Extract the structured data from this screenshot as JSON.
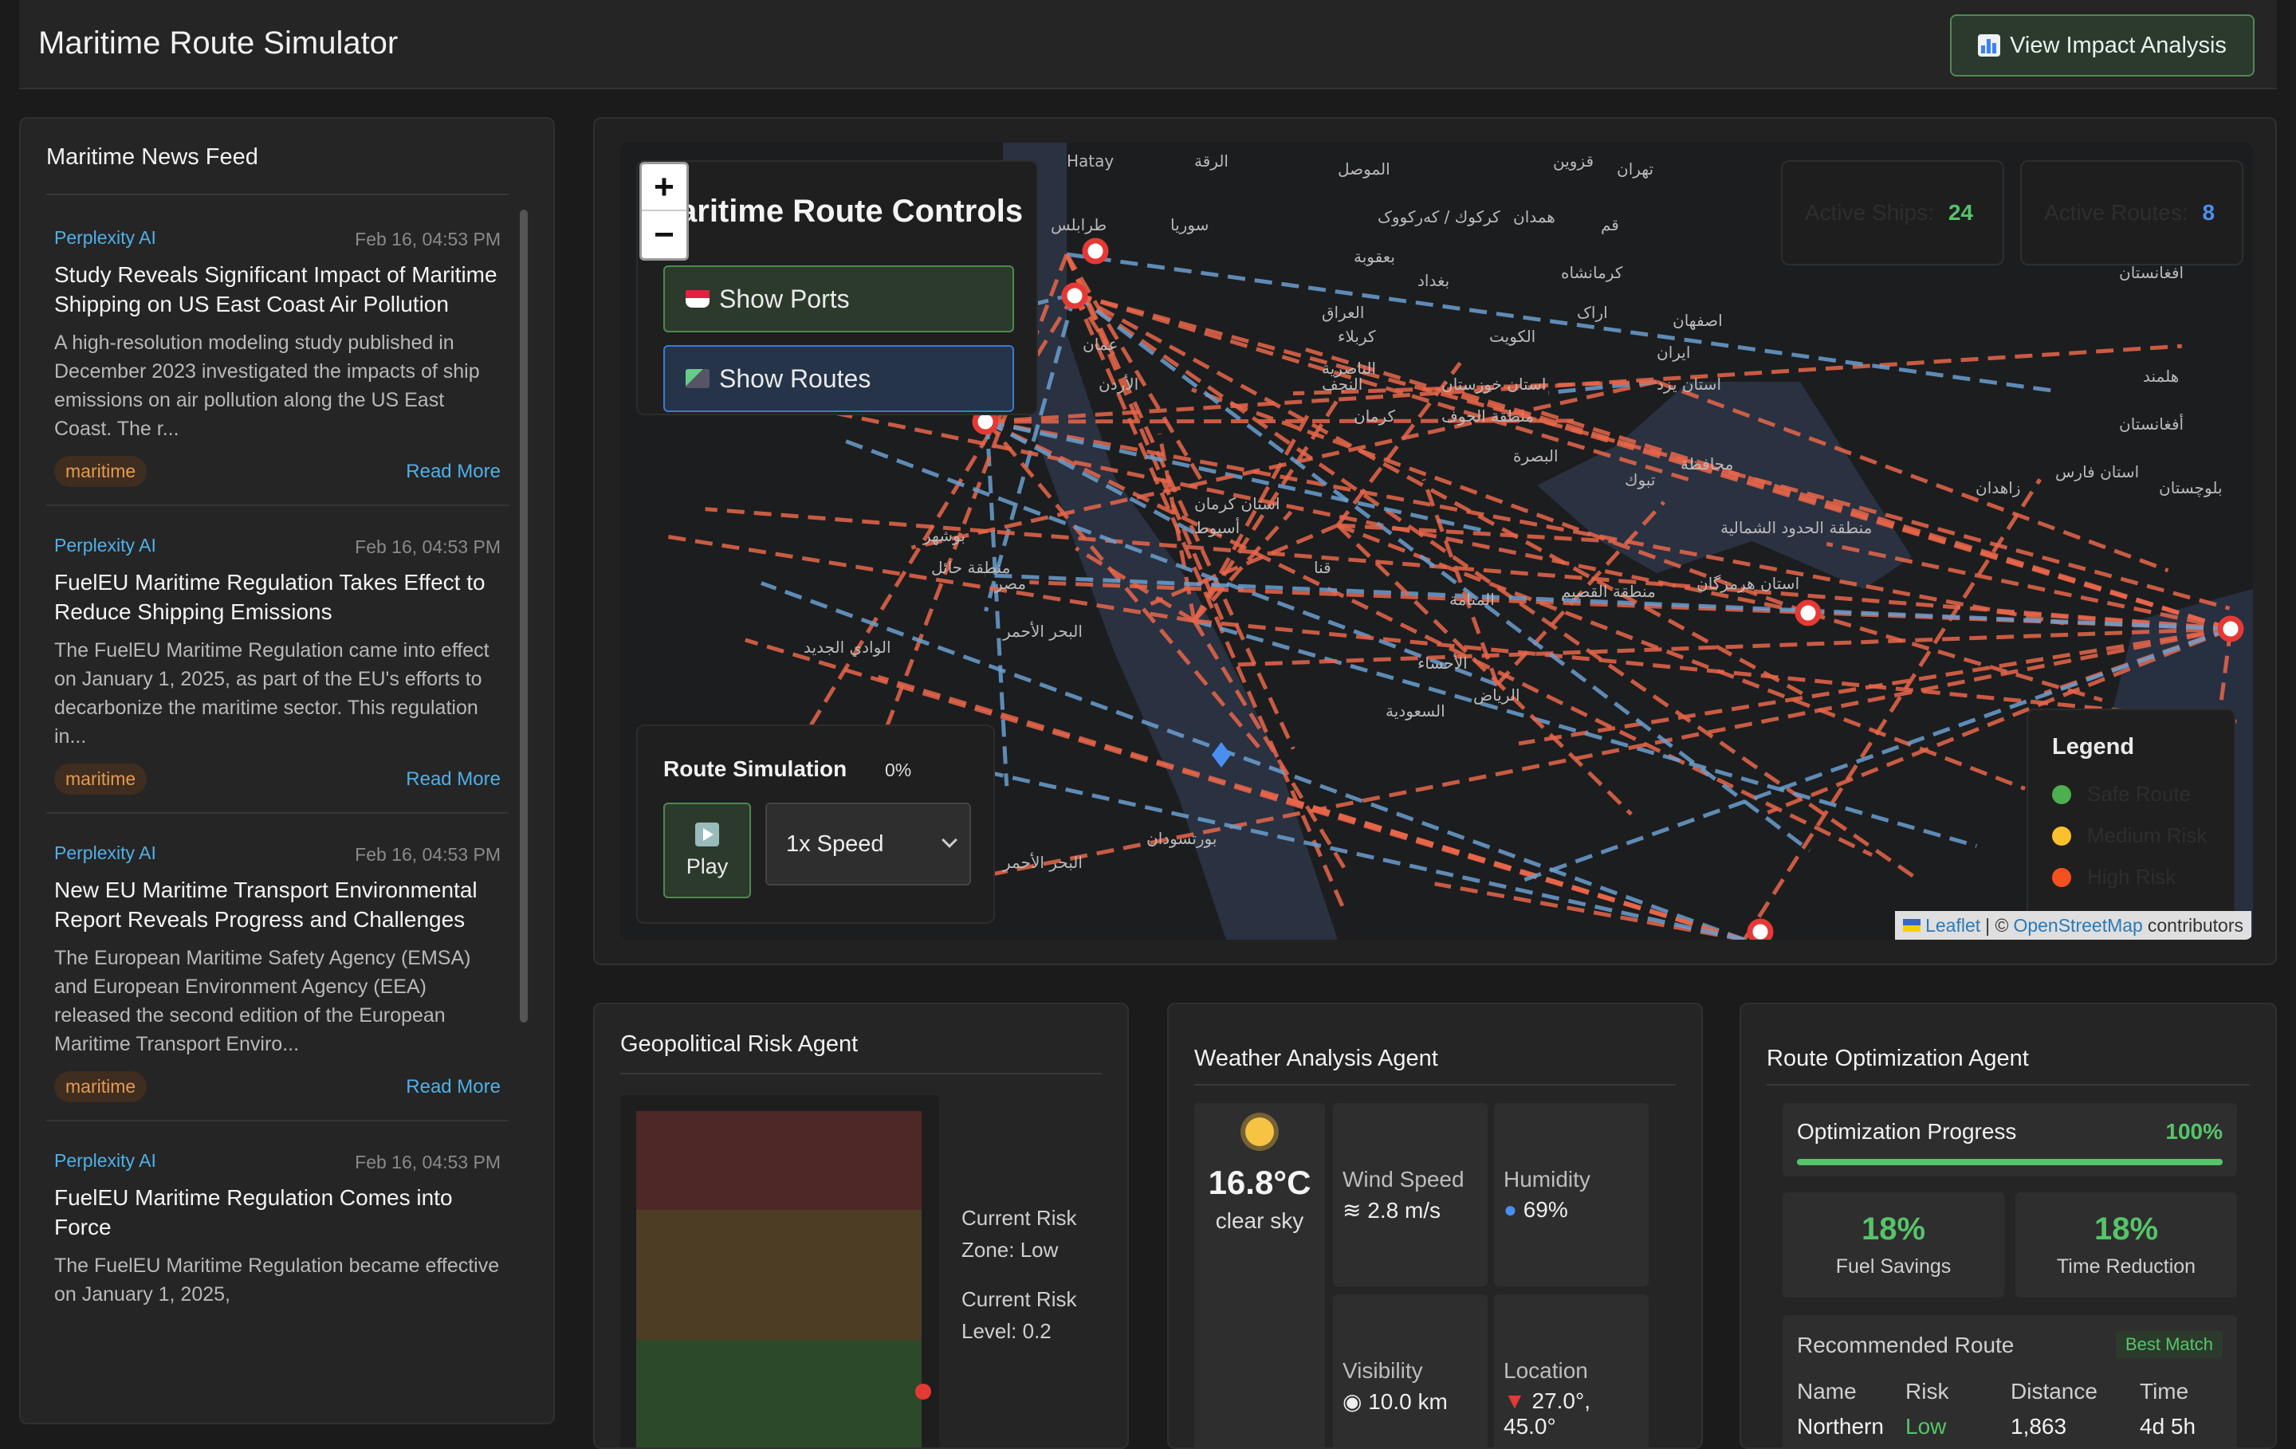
{
  "header": {
    "title": "Maritime Route Simulator",
    "impact_button": "View Impact Analysis"
  },
  "news": {
    "title": "Maritime News Feed",
    "items": [
      {
        "source": "Perplexity AI",
        "date": "Feb 16, 04:53 PM",
        "title": "Study Reveals Significant Impact of Maritime Shipping on US East Coast Air Pollution",
        "desc": "A high-resolution modeling study published in December 2023 investigated the impacts of ship emissions on air pollution along the US East Coast. The r...",
        "tag": "maritime",
        "link": "Read More"
      },
      {
        "source": "Perplexity AI",
        "date": "Feb 16, 04:53 PM",
        "title": "FuelEU Maritime Regulation Takes Effect to Reduce Shipping Emissions",
        "desc": "The FuelEU Maritime Regulation came into effect on January 1, 2025, as part of the EU's efforts to decarbonize the maritime sector. This regulation in...",
        "tag": "maritime",
        "link": "Read More"
      },
      {
        "source": "Perplexity AI",
        "date": "Feb 16, 04:53 PM",
        "title": "New EU Maritime Transport Environmental Report Reveals Progress and Challenges",
        "desc": "The European Maritime Safety Agency (EMSA) and European Environment Agency (EEA) released the second edition of the European Maritime Transport Enviro...",
        "tag": "maritime",
        "link": "Read More"
      },
      {
        "source": "Perplexity AI",
        "date": "Feb 16, 04:53 PM",
        "title": "FuelEU Maritime Regulation Comes into Force",
        "desc": "The FuelEU Maritime Regulation became effective on January 1, 2025,",
        "tag": "",
        "link": ""
      }
    ]
  },
  "map": {
    "zoom_in": "+",
    "zoom_out": "−",
    "controls_title": "aritime Route Controls",
    "show_ports": "Show Ports",
    "show_routes": "Show Routes",
    "active_ships_label": "Active Ships:",
    "active_ships": "24",
    "active_routes_label": "Active Routes:",
    "active_routes": "8",
    "simulation_title": "Route Simulation",
    "simulation_pct": "0%",
    "play": "Play",
    "speed": "1x Speed",
    "legend_title": "Legend",
    "legend": [
      {
        "label": "Safe Route",
        "color": "#4caf50"
      },
      {
        "label": "Medium Risk",
        "color": "#fbc02d"
      },
      {
        "label": "High Risk",
        "color": "#f4511e"
      }
    ],
    "attribution_leaflet": "Leaflet",
    "attribution_sep": "| ©",
    "attribution_osm": "OpenStreetMap",
    "attribution_tail": "contributors",
    "labels": [
      "Hatay",
      "الرقة",
      "الموصل",
      "قزوين",
      "تهران",
      "طرابلس",
      "سوريا",
      "كركوك / كەركووک",
      "همدان",
      "قم",
      "بغداد",
      "كرمانشاه",
      "العراق",
      "اراک",
      "بعقوبة",
      "كربلاء",
      "اصفهان",
      "افغانستان",
      "عمان",
      "الكويت",
      "ایران",
      "الأردن",
      "النجف",
      "الناصرية",
      "استان خوزستان",
      "استان يزد",
      "هلمند",
      "كرمان",
      "منطقة الجوف",
      "منطقة الحدود الشمالية",
      "البصرة",
      "محافظة",
      "استان فارس",
      "زاهدان",
      "استان كرمان",
      "تبوك",
      "بوشهر",
      "أسيوط",
      "منطقة حائل",
      "مصر",
      "قنا",
      "منطقة القصيم",
      "المنامة",
      "استان هرمزگان",
      "البحر الأحمر",
      "الوادي الجديد",
      "الأحساء",
      "الرياض",
      "السعودية",
      "بورتسودان",
      "البحر الأحمر",
      "أفغانستان",
      "بلوچستان"
    ]
  },
  "geo": {
    "title": "Geopolitical Risk Agent",
    "zone": "Current Risk Zone: Low",
    "level": "Current Risk Level: 0.2"
  },
  "weather": {
    "title": "Weather Analysis Agent",
    "temp": "16.8°C",
    "cond": "clear sky",
    "wind_label": "Wind Speed",
    "wind": "2.8 m/s",
    "humidity_label": "Humidity",
    "humidity": "69%",
    "visibility_label": "Visibility",
    "visibility": "10.0 km",
    "location_label": "Location",
    "location": "27.0°, 45.0°"
  },
  "route": {
    "title": "Route Optimization Agent",
    "progress_label": "Optimization Progress",
    "progress": "100%",
    "progress_value": 1.0,
    "fuel_value": "18%",
    "fuel_label": "Fuel Savings",
    "time_value": "18%",
    "time_label": "Time Reduction",
    "rec_title": "Recommended Route",
    "badge": "Best Match",
    "cols": [
      {
        "h": "Name",
        "d": "Northern"
      },
      {
        "h": "Risk",
        "d": "Low"
      },
      {
        "h": "Distance",
        "d": "1,863"
      },
      {
        "h": "Time",
        "d": "4d 5h"
      }
    ]
  }
}
